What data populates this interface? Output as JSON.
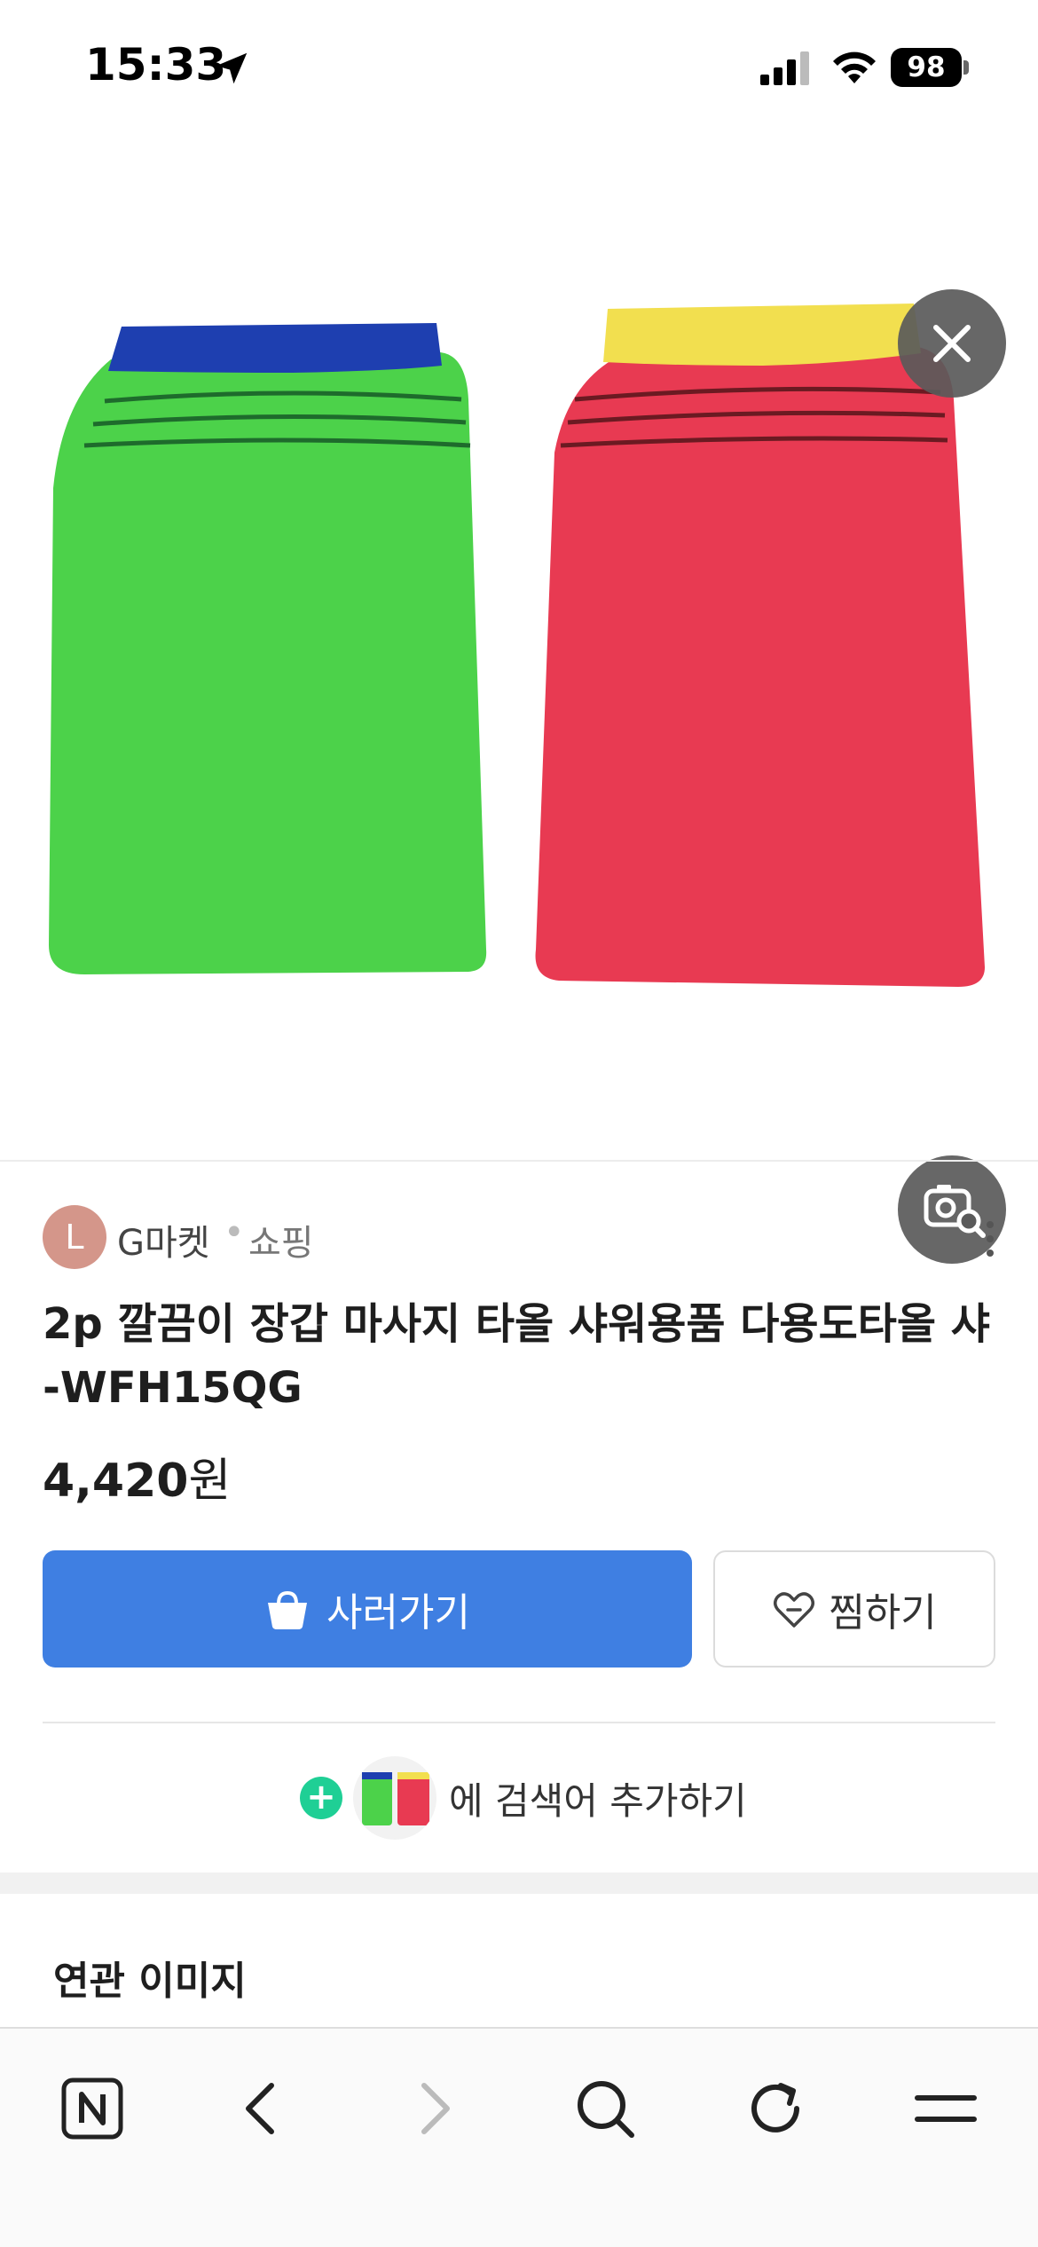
{
  "status_bar": {
    "time": "15:33",
    "battery": "98",
    "icons": [
      "location-arrow-icon",
      "cellular-signal-icon",
      "wifi-icon",
      "battery-icon"
    ]
  },
  "image_viewer": {
    "image_description_icons": [
      "close-icon",
      "visual-search-icon"
    ]
  },
  "seller": {
    "avatar_letter": "L",
    "name": "G마켓",
    "separator": "•",
    "category": "쇼핑"
  },
  "product": {
    "title": "2p 깔끔이 장갑 마사지 타올 샤워용품 다용도타올 샤 -WFH15QG",
    "price_value": "4,420",
    "price_unit": "원"
  },
  "actions": {
    "buy_label": "사러가기",
    "wish_label": "찜하기"
  },
  "add_search": {
    "label": "에 검색어 추가하기"
  },
  "related": {
    "title": "연관 이미지"
  },
  "toolbar": {
    "items": [
      "naver-home-icon",
      "back-icon",
      "forward-icon",
      "search-icon",
      "refresh-icon",
      "menu-icon"
    ]
  },
  "colors": {
    "buy_button": "#3f7fe2",
    "plus_icon": "#1fcf95",
    "avatar": "#d4968a"
  }
}
